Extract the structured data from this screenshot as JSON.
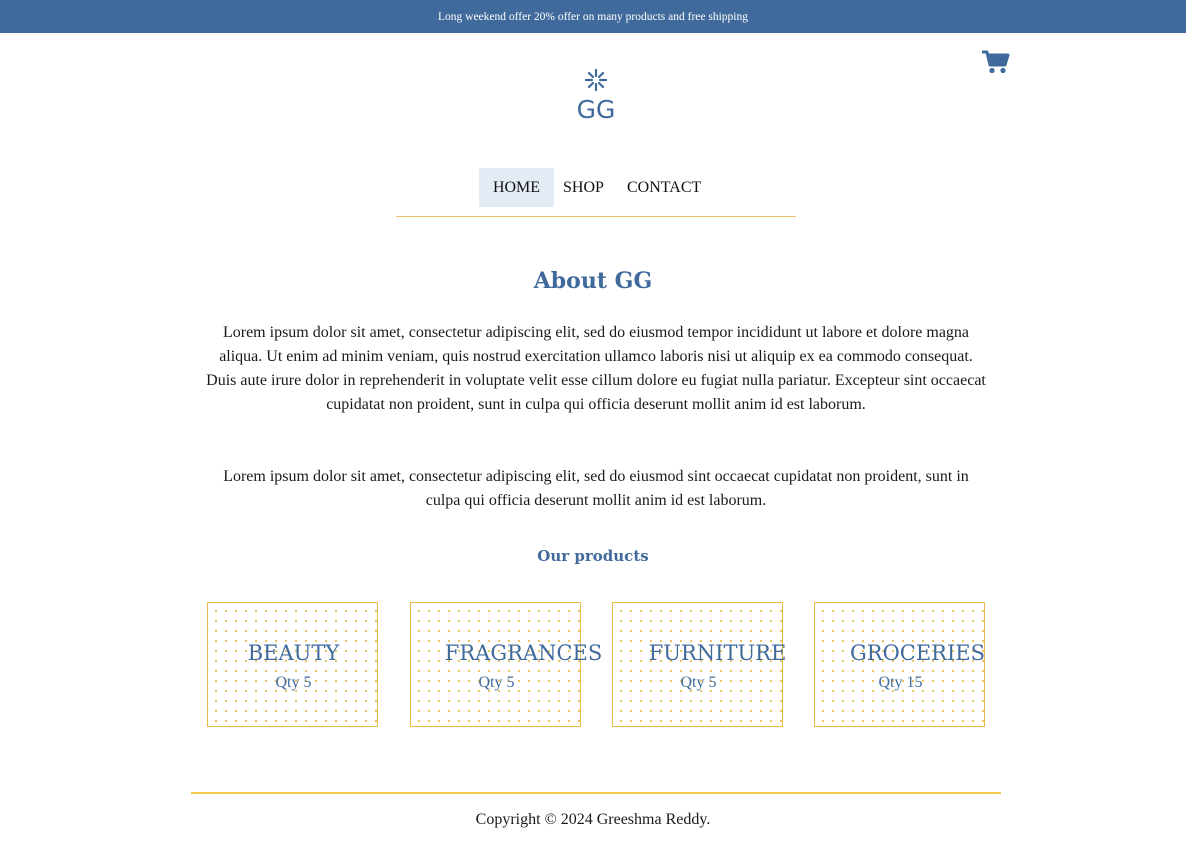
{
  "promo": {
    "text": "Long weekend offer 20% offer on many products and free shipping"
  },
  "header": {
    "logo_text": "GG",
    "cart_icon": "shopping-cart-icon"
  },
  "nav": {
    "items": [
      {
        "label": "HOME",
        "active": true
      },
      {
        "label": "SHOP",
        "active": false
      },
      {
        "label": "CONTACT",
        "active": false
      }
    ]
  },
  "about": {
    "title": "About GG",
    "paragraphs": [
      "Lorem ipsum dolor sit amet, consectetur adipiscing elit, sed do eiusmod tempor incididunt ut labore et dolore magna aliqua. Ut enim ad minim veniam, quis nostrud exercitation ullamco laboris nisi ut aliquip ex ea commodo consequat. Duis aute irure dolor in reprehenderit in voluptate velit esse cillum dolore eu fugiat nulla pariatur. Excepteur sint occaecat cupidatat non proident, sunt in culpa qui officia deserunt mollit anim id est laborum.",
      "Lorem ipsum dolor sit amet, consectetur adipiscing elit, sed do eiusmod sint occaecat cupidatat non proident, sunt in culpa qui officia deserunt mollit anim id est laborum."
    ]
  },
  "products": {
    "title": "Our products",
    "items": [
      {
        "name": "BEAUTY",
        "qty": "Qty 5"
      },
      {
        "name": "FRAGRANCES",
        "qty": "Qty 5"
      },
      {
        "name": "FURNITURE",
        "qty": "Qty 5"
      },
      {
        "name": "GROCERIES",
        "qty": "Qty 15"
      }
    ]
  },
  "footer": {
    "copyright": "Copyright © 2024 Greeshma Reddy."
  },
  "colors": {
    "brand_blue": "#3f6a9b",
    "accent_gold": "#e9b949",
    "nav_active_bg": "#e3ebf5"
  }
}
